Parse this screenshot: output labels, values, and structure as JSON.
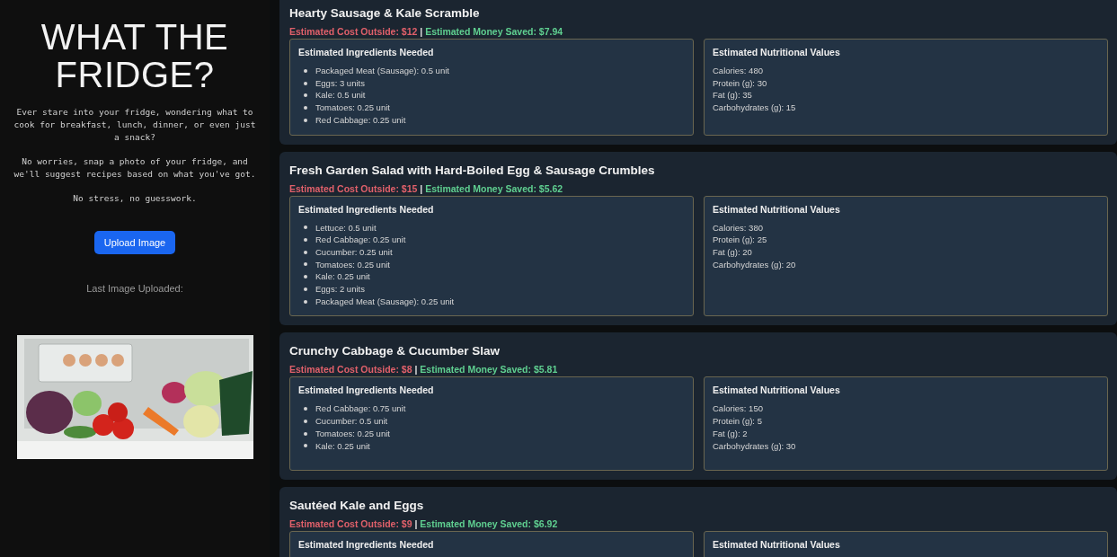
{
  "sidebar": {
    "title": "WHAT THE FRIDGE?",
    "paragraphs": [
      "Ever stare into your fridge, wondering what to cook for breakfast, lunch, dinner, or even just a snack?",
      "No worries, snap a photo of your fridge, and we'll suggest recipes based on what you've got.",
      "No stress, no guesswork."
    ],
    "upload_button": "Upload Image",
    "last_image_label": "Last Image Uploaded:",
    "last_image": {
      "kind": "picture"
    }
  },
  "recipes": [
    {
      "title": "Hearty Sausage & Kale Scramble",
      "cost": "Estimated Cost Outside: $12",
      "separator": "|",
      "saved": "Estimated Money Saved: $7.94",
      "ingredients_heading": "Estimated Ingredients Needed",
      "ingredients": [
        "Packaged Meat (Sausage): 0.5 unit",
        "Eggs: 3 units",
        "Kale: 0.5 unit",
        "Tomatoes: 0.25 unit",
        "Red Cabbage: 0.25 unit"
      ],
      "nutrition_heading": "Estimated Nutritional Values",
      "nutrition": [
        "Calories: 480",
        "Protein (g): 30",
        "Fat (g): 35",
        "Carbohydrates (g): 15"
      ]
    },
    {
      "title": "Fresh Garden Salad with Hard-Boiled Egg & Sausage Crumbles",
      "cost": "Estimated Cost Outside: $15",
      "separator": "|",
      "saved": "Estimated Money Saved: $5.62",
      "ingredients_heading": "Estimated Ingredients Needed",
      "ingredients": [
        "Lettuce: 0.5 unit",
        "Red Cabbage: 0.25 unit",
        "Cucumber: 0.25 unit",
        "Tomatoes: 0.25 unit",
        "Kale: 0.25 unit",
        "Eggs: 2 units",
        "Packaged Meat (Sausage): 0.25 unit"
      ],
      "nutrition_heading": "Estimated Nutritional Values",
      "nutrition": [
        "Calories: 380",
        "Protein (g): 25",
        "Fat (g): 20",
        "Carbohydrates (g): 20"
      ]
    },
    {
      "title": "Crunchy Cabbage & Cucumber Slaw",
      "cost": "Estimated Cost Outside: $8",
      "separator": "|",
      "saved": "Estimated Money Saved: $5.81",
      "ingredients_heading": "Estimated Ingredients Needed",
      "ingredients": [
        "Red Cabbage: 0.75 unit",
        "Cucumber: 0.5 unit",
        "Tomatoes: 0.25 unit",
        "Kale: 0.25 unit"
      ],
      "nutrition_heading": "Estimated Nutritional Values",
      "nutrition": [
        "Calories: 150",
        "Protein (g): 5",
        "Fat (g): 2",
        "Carbohydrates (g): 30"
      ]
    },
    {
      "title": "Sautéed Kale and Eggs",
      "cost": "Estimated Cost Outside: $9",
      "separator": "|",
      "saved": "Estimated Money Saved: $6.92",
      "ingredients_heading": "Estimated Ingredients Needed",
      "nutrition_heading": "Estimated Nutritional Values"
    }
  ]
}
